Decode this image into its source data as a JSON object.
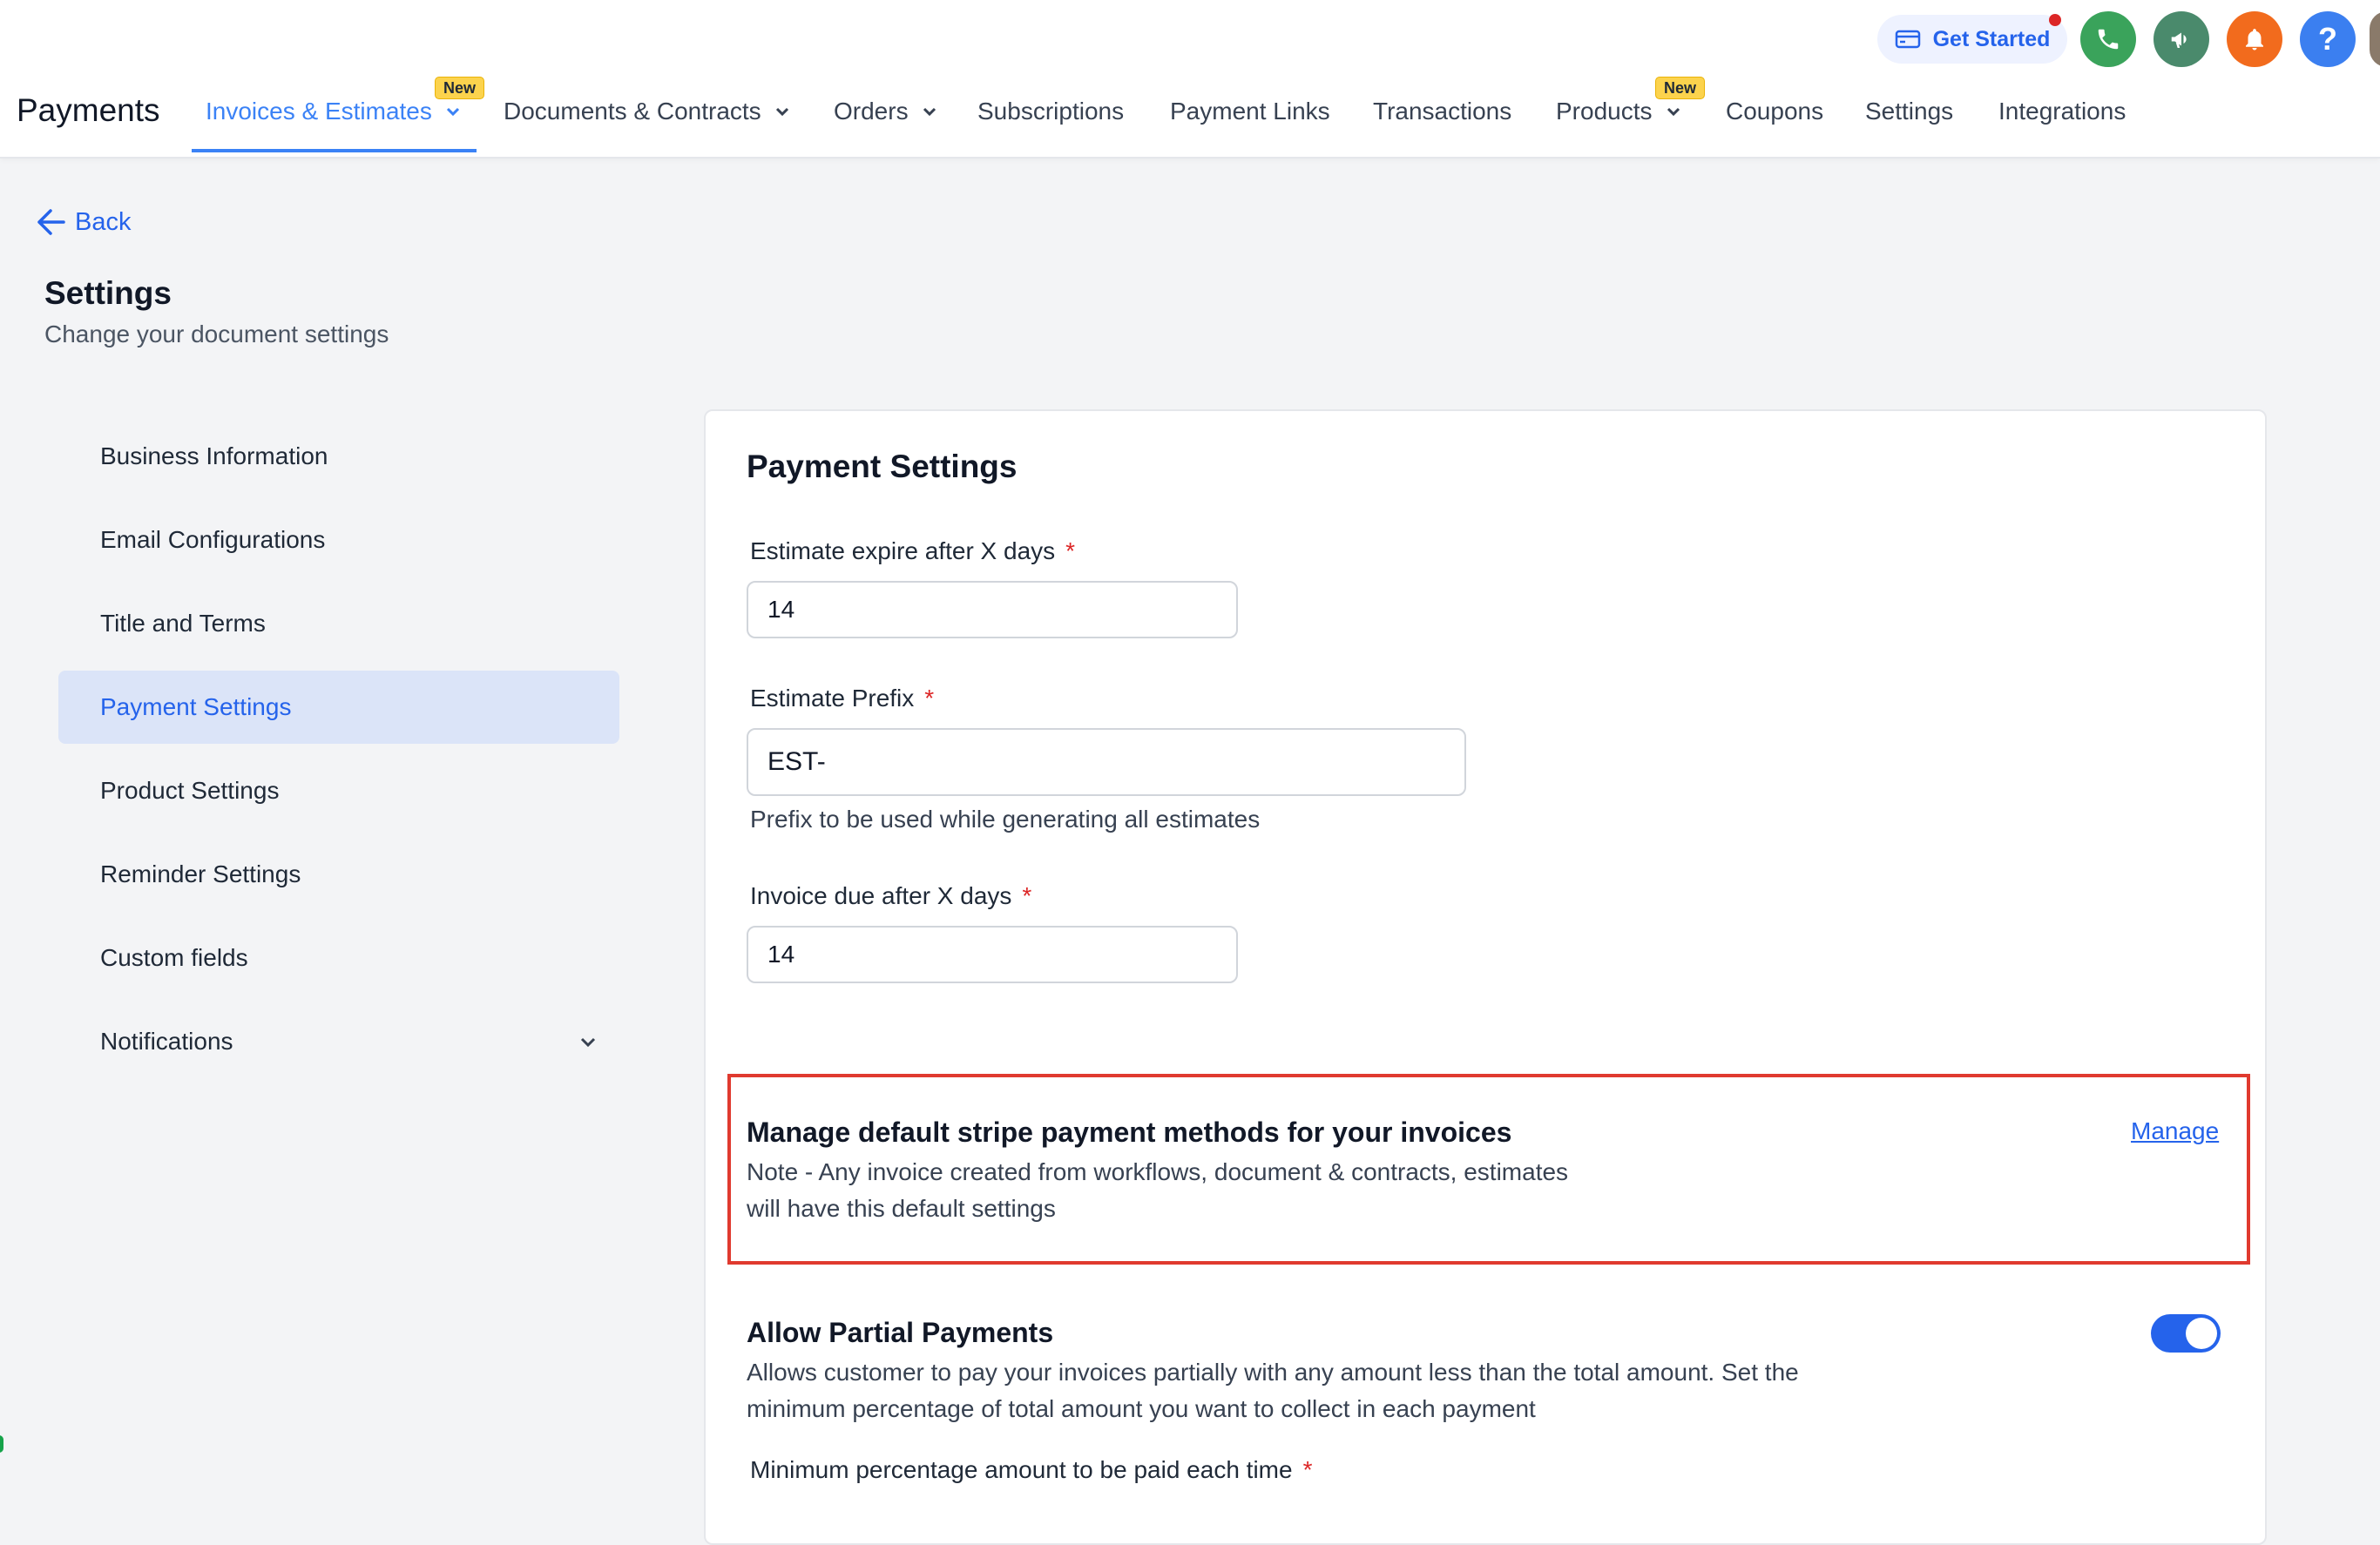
{
  "app": {
    "title": "Payments"
  },
  "nav": {
    "items": [
      {
        "label": "Invoices & Estimates",
        "badge": "New",
        "dropdown": true,
        "active": true
      },
      {
        "label": "Documents & Contracts",
        "dropdown": true
      },
      {
        "label": "Orders",
        "dropdown": true
      },
      {
        "label": "Subscriptions"
      },
      {
        "label": "Payment Links"
      },
      {
        "label": "Transactions"
      },
      {
        "label": "Products",
        "badge": "New",
        "dropdown": true
      },
      {
        "label": "Coupons"
      },
      {
        "label": "Settings"
      },
      {
        "label": "Integrations"
      }
    ]
  },
  "topbar": {
    "get_started": "Get Started",
    "icons": [
      "phone-icon",
      "megaphone-icon",
      "bell-icon",
      "help-icon"
    ],
    "colors": {
      "phone": "#3aa35b",
      "megaphone": "#4a8a6c",
      "bell": "#f26b1d",
      "help": "#3b7ff0"
    }
  },
  "page": {
    "back": "Back",
    "title": "Settings",
    "subtitle": "Change your document settings"
  },
  "sidebar": {
    "items": [
      {
        "label": "Business Information"
      },
      {
        "label": "Email Configurations"
      },
      {
        "label": "Title and Terms"
      },
      {
        "label": "Payment Settings",
        "active": true
      },
      {
        "label": "Product Settings"
      },
      {
        "label": "Reminder Settings"
      },
      {
        "label": "Custom fields"
      },
      {
        "label": "Notifications",
        "expandable": true
      }
    ]
  },
  "card": {
    "title": "Payment Settings",
    "fields": {
      "estimate_expire": {
        "label": "Estimate expire after X days",
        "required": "*",
        "value": "14"
      },
      "estimate_prefix": {
        "label": "Estimate Prefix",
        "required": "*",
        "value": "EST-",
        "help": "Prefix to be used while generating all estimates"
      },
      "invoice_due": {
        "label": "Invoice due after X days",
        "required": "*",
        "value": "14"
      }
    },
    "stripe": {
      "title": "Manage default stripe payment methods for your invoices",
      "note_line1": "Note - Any invoice created from workflows, document & contracts, estimates",
      "note_line2": "will have this default settings",
      "link": "Manage"
    },
    "partial": {
      "title": "Allow Partial Payments",
      "desc_line1": "Allows customer to pay your invoices partially with any amount less than the total amount. Set the",
      "desc_line2": "minimum percentage of total amount you want to collect in each payment",
      "enabled": true,
      "next_label": "Minimum percentage amount to be paid each time",
      "next_required": "*"
    }
  }
}
